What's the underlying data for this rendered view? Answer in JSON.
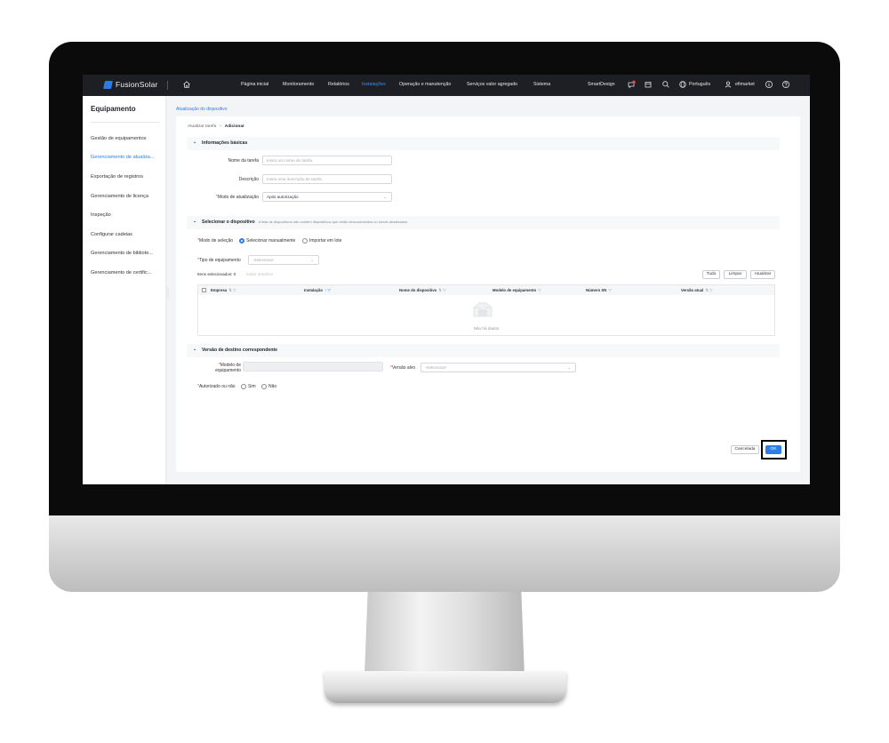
{
  "app": {
    "logo_text": "FusionSolar"
  },
  "topnav": {
    "items": [
      "Página inicial",
      "Monitoramento",
      "Relatórios",
      "Instalações",
      "Operação e manutenção",
      "Serviços valor agregado",
      "Sistema"
    ],
    "active": "Instalações",
    "smartdesign": "SmartDesign",
    "language": "Português",
    "user": "efimarket"
  },
  "sidebar": {
    "title": "Equipamento",
    "items": [
      "Gestão de equipamentos",
      "Gerenciamento de atualiza...",
      "Exportação de registros",
      "Gerenciamento de licença",
      "Inspeção",
      "Configurar cadeias",
      "Gerenciamento de bibliote...",
      "Gerenciamento de certific..."
    ],
    "active_index": 1
  },
  "breadcrumb": {
    "top": "Atualização do dispositivo",
    "parent": "Atualizar tarefa",
    "separator": ">",
    "current": "Adicionar"
  },
  "basic": {
    "title": "Informações básicas",
    "task_name_label": "Nome da tarefa",
    "task_name_placeholder": "Insira um nome de tarefa.",
    "description_label": "Descrição",
    "description_placeholder": "Insira uma descrição de tarefa.",
    "mode_label": "Modo de atualização",
    "mode_value": "Após autorização"
  },
  "select_device": {
    "title": "Selecionar o dispositivo",
    "note": "A lista de dispositivos não contém dispositivos que estão desconectados ou sendo atualizados.",
    "selection_mode_label": "Modo de seleção",
    "option_manual": "Selecionar manualmente",
    "option_import": "Importar em lote",
    "equipment_type_label": "Tipo de equipamento",
    "equipment_type_value": "-Selecionar-",
    "selected_items": "Itens selecionados: 0",
    "show_details": "Exibir detalhes",
    "btn_all": "Tudo",
    "btn_clear": "Limpar",
    "btn_refresh": "Atualizar",
    "columns": [
      "Empresa",
      "Instalação",
      "Nome do dispositivo",
      "Modelo de equipamento",
      "Número SN",
      "Versão atual"
    ],
    "empty_text": "Não há dados"
  },
  "target": {
    "title": "Versão de destino correspondente",
    "model_label": "Modelo de equipamento",
    "target_version_label": "Versão alvo",
    "target_version_value": "-Selecionar-",
    "authorized_label": "Autorizado ou não",
    "yes": "Sim",
    "no": "Não"
  },
  "footer": {
    "cancel": "Cancelada",
    "ok": "OK"
  },
  "colors": {
    "accent": "#2b7de9",
    "topbar": "#1d1f24",
    "required": "#e5484d"
  }
}
